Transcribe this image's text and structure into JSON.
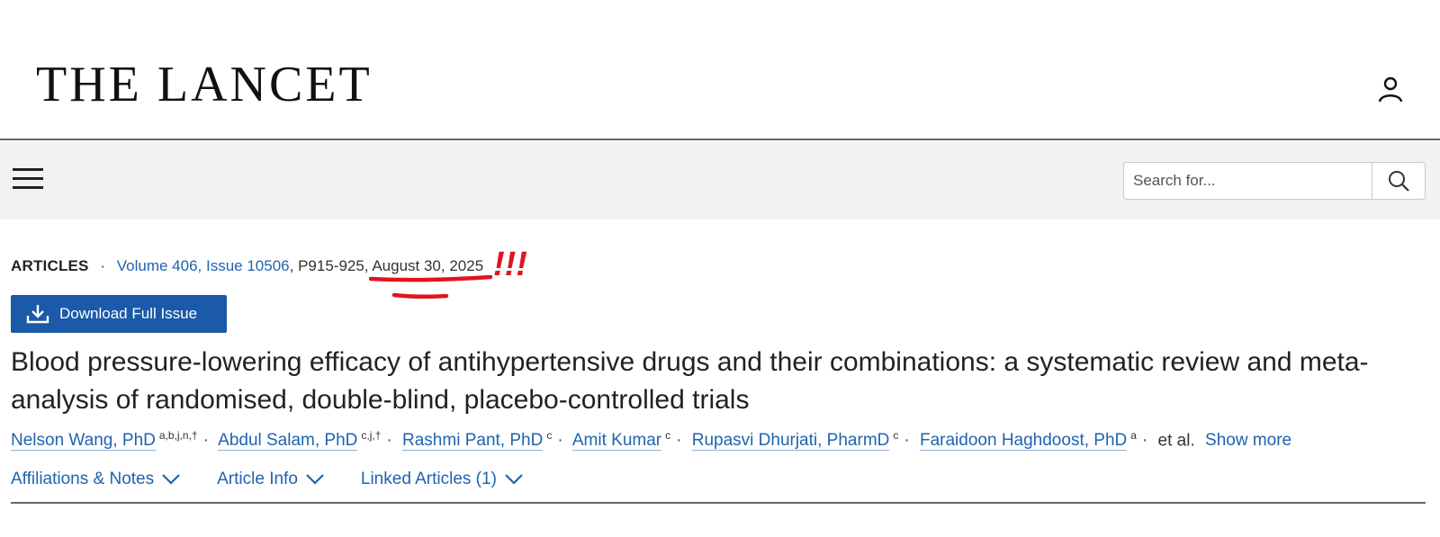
{
  "header": {
    "logo_text": "THE LANCET",
    "user_icon": "user-icon"
  },
  "nav": {
    "menu_icon": "hamburger-menu-icon",
    "search_placeholder": "Search for...",
    "search_icon": "search-icon"
  },
  "article": {
    "type_label": "ARTICLES",
    "issue_link": "Volume 406, Issue 10506",
    "pages": "P915-925,",
    "date": "August 30, 2025",
    "annotation": "!!!",
    "download_label": "Download Full Issue",
    "download_icon": "download-icon",
    "title": "Blood pressure-lowering efficacy of antihypertensive drugs and their combinations: a systematic review and meta-analysis of randomised, double-blind, placebo-controlled trials",
    "authors": [
      {
        "name": "Nelson Wang, PhD",
        "sup": "a,b,j,n,†"
      },
      {
        "name": "Abdul Salam, PhD",
        "sup": "c,j,†"
      },
      {
        "name": "Rashmi Pant, PhD",
        "sup": "c"
      },
      {
        "name": "Amit Kumar",
        "sup": "c"
      },
      {
        "name": "Rupasvi Dhurjati, PharmD",
        "sup": "c"
      },
      {
        "name": "Faraidoon Haghdoost, PhD",
        "sup": "a"
      }
    ],
    "et_al": "et al.",
    "show_more": "Show more",
    "tabs": [
      "Affiliations & Notes",
      "Article Info",
      "Linked Articles (1)"
    ],
    "tab_icon": "chevron-down-icon",
    "colors": {
      "link": "#1f63b0",
      "button": "#1a5aa8",
      "annotation": "#e0141e"
    }
  }
}
